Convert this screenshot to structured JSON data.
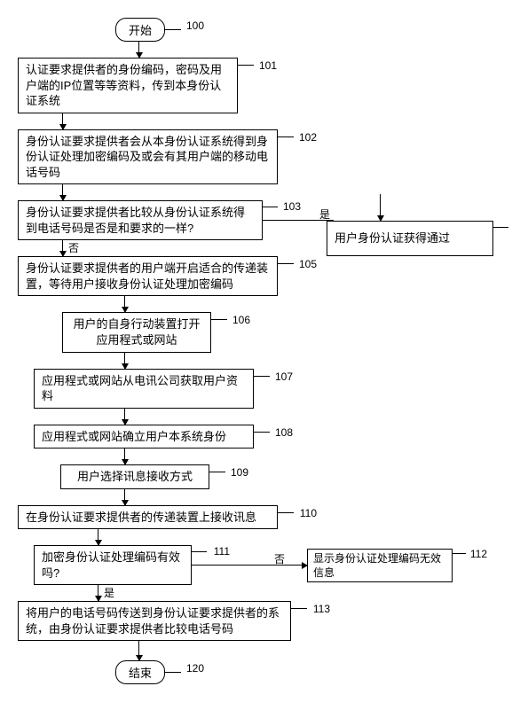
{
  "chart_data": {
    "type": "flowchart",
    "title": "",
    "nodes": [
      {
        "id": "100",
        "type": "terminal",
        "label": "开始"
      },
      {
        "id": "101",
        "type": "process",
        "label": "认证要求提供者的身份编码，密码及用户端的IP位置等等资料，传到本身份认证系统"
      },
      {
        "id": "102",
        "type": "process",
        "label": "身份认证要求提供者会从本身份认证系统得到身份认证处理加密编码及或会有其用户端的移动电话号码"
      },
      {
        "id": "103",
        "type": "decision",
        "label": "身份认证要求提供者比较从身份认证系统得到电话号码是否是和要求的一样?"
      },
      {
        "id": "104",
        "type": "process",
        "label": "用户身份认证获得通过"
      },
      {
        "id": "105",
        "type": "process",
        "label": "身份认证要求提供者的用户端开启适合的传递装置，等待用户接收身份认证处理加密编码"
      },
      {
        "id": "106",
        "type": "process",
        "label": "用户的自身行动装置打开应用程式或网站"
      },
      {
        "id": "107",
        "type": "process",
        "label": "应用程式或网站从电讯公司获取用户资料"
      },
      {
        "id": "108",
        "type": "process",
        "label": "应用程式或网站确立用户本系统身份"
      },
      {
        "id": "109",
        "type": "process",
        "label": "用户选择讯息接收方式"
      },
      {
        "id": "110",
        "type": "process",
        "label": "在身份认证要求提供者的传递装置上接收讯息"
      },
      {
        "id": "111",
        "type": "decision",
        "label": "加密身份认证处理编码有效吗?"
      },
      {
        "id": "112",
        "type": "process",
        "label": "显示身份认证处理编码无效信息"
      },
      {
        "id": "113",
        "type": "process",
        "label": "将用户的电话号码传送到身份认证要求提供者的系统，由身份认证要求提供者比较电话号码"
      },
      {
        "id": "120",
        "type": "terminal",
        "label": "结束"
      }
    ],
    "edges": [
      {
        "from": "100",
        "to": "101"
      },
      {
        "from": "101",
        "to": "102"
      },
      {
        "from": "102",
        "to": "103"
      },
      {
        "from": "103",
        "to": "104",
        "label": "是"
      },
      {
        "from": "103",
        "to": "105",
        "label": "否"
      },
      {
        "from": "105",
        "to": "106"
      },
      {
        "from": "106",
        "to": "107"
      },
      {
        "from": "107",
        "to": "108"
      },
      {
        "from": "108",
        "to": "109"
      },
      {
        "from": "109",
        "to": "110"
      },
      {
        "from": "110",
        "to": "111"
      },
      {
        "from": "111",
        "to": "113",
        "label": "是"
      },
      {
        "from": "111",
        "to": "112",
        "label": "否"
      },
      {
        "from": "113",
        "to": "120"
      }
    ],
    "branch_labels": {
      "yes": "是",
      "no": "否"
    }
  }
}
